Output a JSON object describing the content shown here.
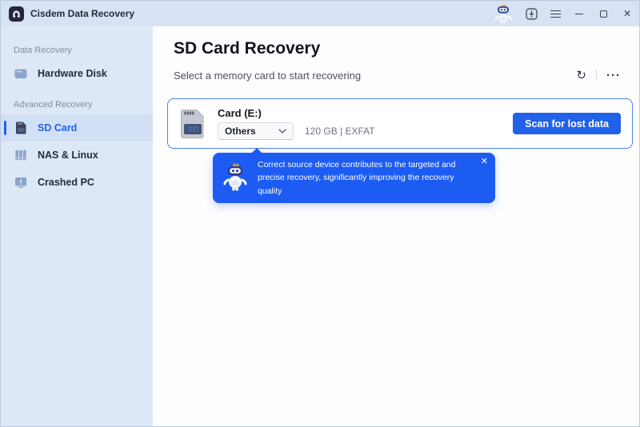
{
  "titlebar": {
    "app_title": "Cisdem Data Recovery"
  },
  "icons": {
    "close_glyph": "✕",
    "refresh_glyph": "↻",
    "more_glyph": "···"
  },
  "sidebar": {
    "sections": [
      {
        "label": "Data Recovery",
        "items": [
          {
            "label": "Hardware Disk",
            "icon": "hardware-disk-icon",
            "selected": false
          }
        ]
      },
      {
        "label": "Advanced Recovery",
        "items": [
          {
            "label": "SD Card",
            "icon": "sd-card-icon",
            "selected": true
          },
          {
            "label": "NAS & Linux",
            "icon": "nas-server-icon",
            "selected": false
          },
          {
            "label": "Crashed PC",
            "icon": "crashed-pc-icon",
            "selected": false
          }
        ]
      }
    ]
  },
  "main": {
    "title": "SD Card Recovery",
    "subtitle": "Select a memory card to start recovering",
    "device": {
      "name": "Card (E:)",
      "filesystem_dropdown_value": "Others",
      "capacity_info": "120 GB | EXFAT",
      "scan_button_label": "Scan for lost data",
      "card_icon_label": "SD"
    },
    "tooltip": {
      "text": "Correct source device contributes to the targeted and precise recovery, significantly improving the recovery quality"
    }
  },
  "colors": {
    "accent": "#2161e9",
    "tooltip_bg": "#1d5cf2",
    "titlebar_bg": "#d7e3f4",
    "sidebar_bg": "#dde8f7",
    "selected_item_bg": "#d2e0f5",
    "card_border": "#4b82f0",
    "main_bg": "#fdfdfe"
  }
}
